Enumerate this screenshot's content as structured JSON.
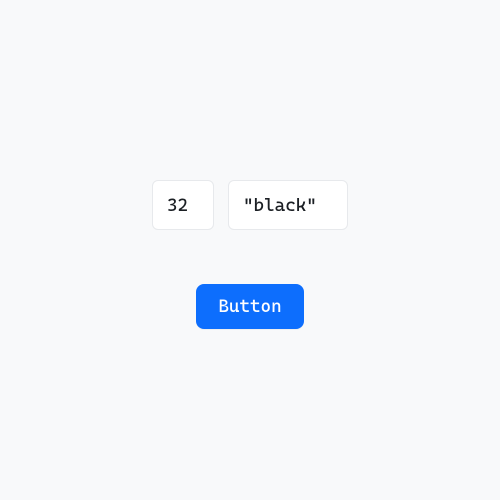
{
  "inputs": {
    "number_value": "32",
    "color_value": "\"black\""
  },
  "actions": {
    "button_label": "Button"
  },
  "colors": {
    "accent": "#0d6efd"
  }
}
